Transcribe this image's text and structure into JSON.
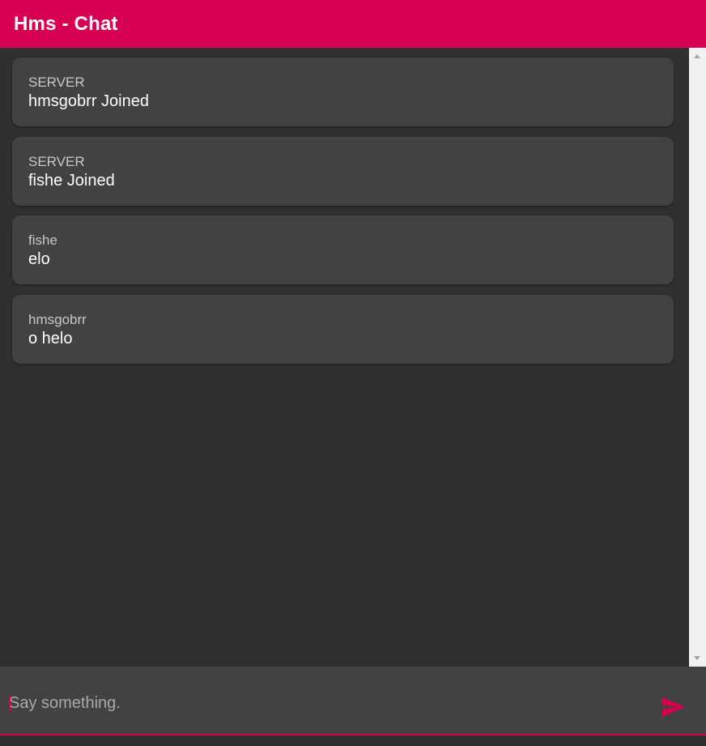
{
  "header": {
    "title": "Hms - Chat"
  },
  "messages": [
    {
      "author": "SERVER",
      "text": "hmsgobrr Joined"
    },
    {
      "author": "SERVER",
      "text": "fishe Joined"
    },
    {
      "author": "fishe",
      "text": "elo"
    },
    {
      "author": "hmsgobrr",
      "text": "o helo"
    }
  ],
  "composer": {
    "placeholder": "Say something.",
    "value": "",
    "send_icon": "send-icon"
  },
  "colors": {
    "accent": "#d70050",
    "background": "#303030",
    "card": "#424242"
  }
}
